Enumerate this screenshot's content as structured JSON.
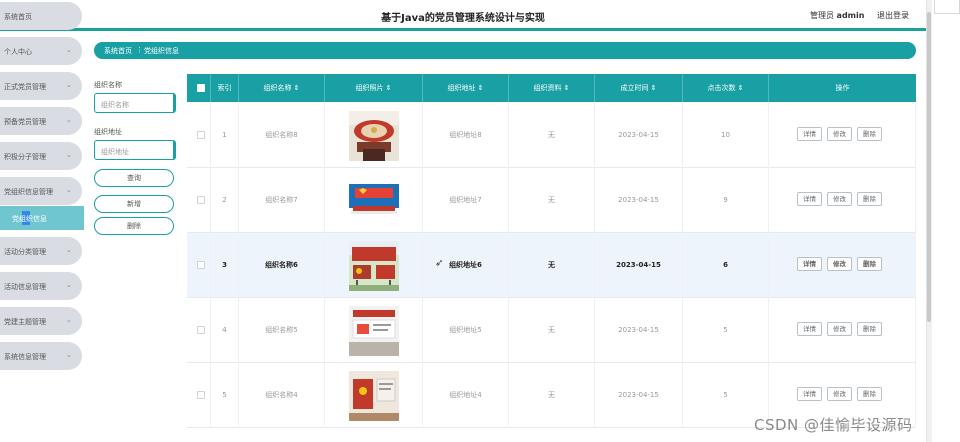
{
  "header": {
    "title": "基于Java的党员管理系统设计与实现",
    "user_role": "管理员",
    "user_name": "admin",
    "logout_label": "退出登录"
  },
  "sidebar": {
    "items": [
      {
        "label": "系统首页",
        "has_chevron": false
      },
      {
        "label": "个人中心",
        "has_chevron": true
      },
      {
        "label": "正式党员管理",
        "has_chevron": true
      },
      {
        "label": "预备党员管理",
        "has_chevron": true
      },
      {
        "label": "积极分子管理",
        "has_chevron": true
      },
      {
        "label": "党组织信息管理",
        "has_chevron": true
      },
      {
        "label": "活动分类管理",
        "has_chevron": true
      },
      {
        "label": "活动信息管理",
        "has_chevron": true
      },
      {
        "label": "党建主题管理",
        "has_chevron": true
      },
      {
        "label": "系统信息管理",
        "has_chevron": true
      }
    ],
    "active_sub": "党组织信息"
  },
  "breadcrumb": {
    "home": "系统首页",
    "separator": "⋮",
    "current": "党组织信息"
  },
  "filters": {
    "name_label": "组织名称",
    "name_placeholder": "组织名称",
    "address_label": "组织地址",
    "address_placeholder": "组织地址",
    "search_btn": "查询",
    "add_btn": "新增",
    "delete_btn": "删除"
  },
  "table": {
    "columns": [
      "索引",
      "组织名称 ⇕",
      "组织照片 ⇕",
      "组织地址 ⇕",
      "组织资料 ⇕",
      "成立时间 ⇕",
      "点击次数 ⇕",
      "操作"
    ],
    "rows": [
      {
        "index": "1",
        "name": "组织名称8",
        "photo": "photo-red-hall",
        "address": "组织地址8",
        "info": "无",
        "date": "2023-04-15",
        "clicks": "10"
      },
      {
        "index": "2",
        "name": "组织名称7",
        "photo": "photo-stage",
        "address": "组织地址7",
        "info": "无",
        "date": "2023-04-15",
        "clicks": "9"
      },
      {
        "index": "3",
        "name": "组织名称6",
        "photo": "photo-outdoor-flags",
        "address": "组织地址6",
        "info": "无",
        "date": "2023-04-15",
        "clicks": "6"
      },
      {
        "index": "4",
        "name": "组织名称5",
        "photo": "photo-wall-banner",
        "address": "组织地址5",
        "info": "无",
        "date": "2023-04-15",
        "clicks": "5"
      },
      {
        "index": "5",
        "name": "组织名称4",
        "photo": "photo-exhibit-room",
        "address": "组织地址4",
        "info": "无",
        "date": "2023-04-15",
        "clicks": "5"
      }
    ],
    "actions": {
      "detail": "详情",
      "edit": "修改",
      "delete": "删除"
    }
  },
  "watermark": "CSDN @佳愉毕设源码",
  "colors": {
    "accent": "#19a0a4",
    "sidebar_bg": "#d9dde3",
    "active_sub_bg": "#6fc6d0",
    "highlight_row": "#eef4fb"
  }
}
